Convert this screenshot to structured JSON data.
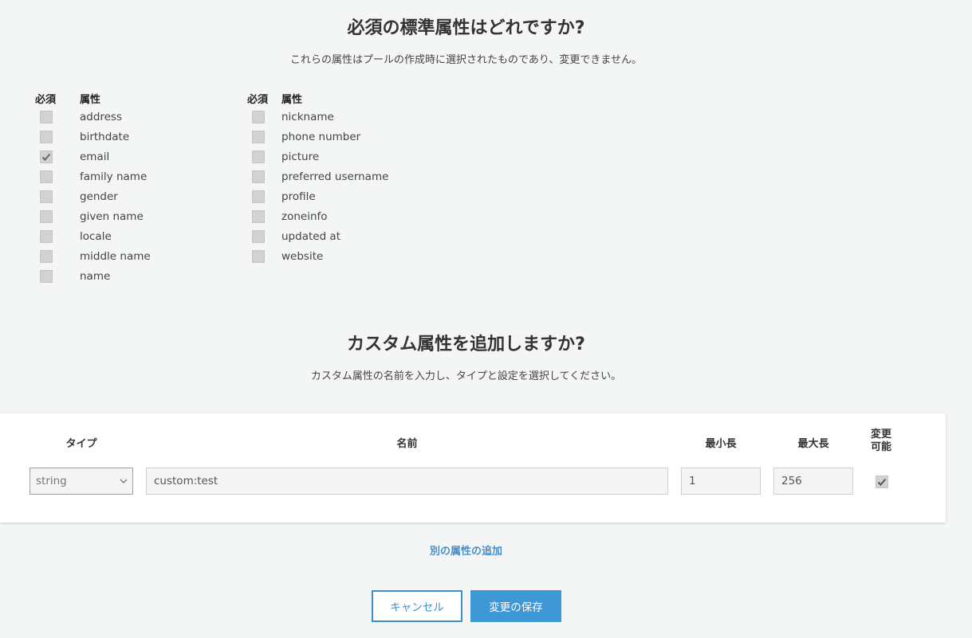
{
  "standard": {
    "title": "必須の標準属性はどれですか?",
    "subtitle": "これらの属性はプールの作成時に選択されたものであり、変更できません。",
    "required_header": "必須",
    "attribute_header": "属性",
    "left_attributes": [
      {
        "label": "address",
        "required": false
      },
      {
        "label": "birthdate",
        "required": false
      },
      {
        "label": "email",
        "required": true
      },
      {
        "label": "family name",
        "required": false
      },
      {
        "label": "gender",
        "required": false
      },
      {
        "label": "given name",
        "required": false
      },
      {
        "label": "locale",
        "required": false
      },
      {
        "label": "middle name",
        "required": false
      },
      {
        "label": "name",
        "required": false
      }
    ],
    "right_attributes": [
      {
        "label": "nickname",
        "required": false
      },
      {
        "label": "phone number",
        "required": false
      },
      {
        "label": "picture",
        "required": false
      },
      {
        "label": "preferred username",
        "required": false
      },
      {
        "label": "profile",
        "required": false
      },
      {
        "label": "zoneinfo",
        "required": false
      },
      {
        "label": "updated at",
        "required": false
      },
      {
        "label": "website",
        "required": false
      }
    ]
  },
  "custom": {
    "title": "カスタム属性を追加しますか?",
    "subtitle": "カスタム属性の名前を入力し、タイプと設定を選択してください。",
    "headers": {
      "type": "タイプ",
      "name": "名前",
      "min_length": "最小長",
      "max_length": "最大長",
      "mutable_line1": "変更",
      "mutable_line2": "可能"
    },
    "row": {
      "type": "string",
      "name": "custom:test",
      "min_length": "1",
      "max_length": "256",
      "mutable": true
    },
    "add_another_label": "別の属性の追加"
  },
  "actions": {
    "cancel_label": "キャンセル",
    "save_label": "変更の保存"
  },
  "colors": {
    "accent": "#3e98d5",
    "link": "#4a8fc9",
    "background": "#f4f6f6"
  }
}
